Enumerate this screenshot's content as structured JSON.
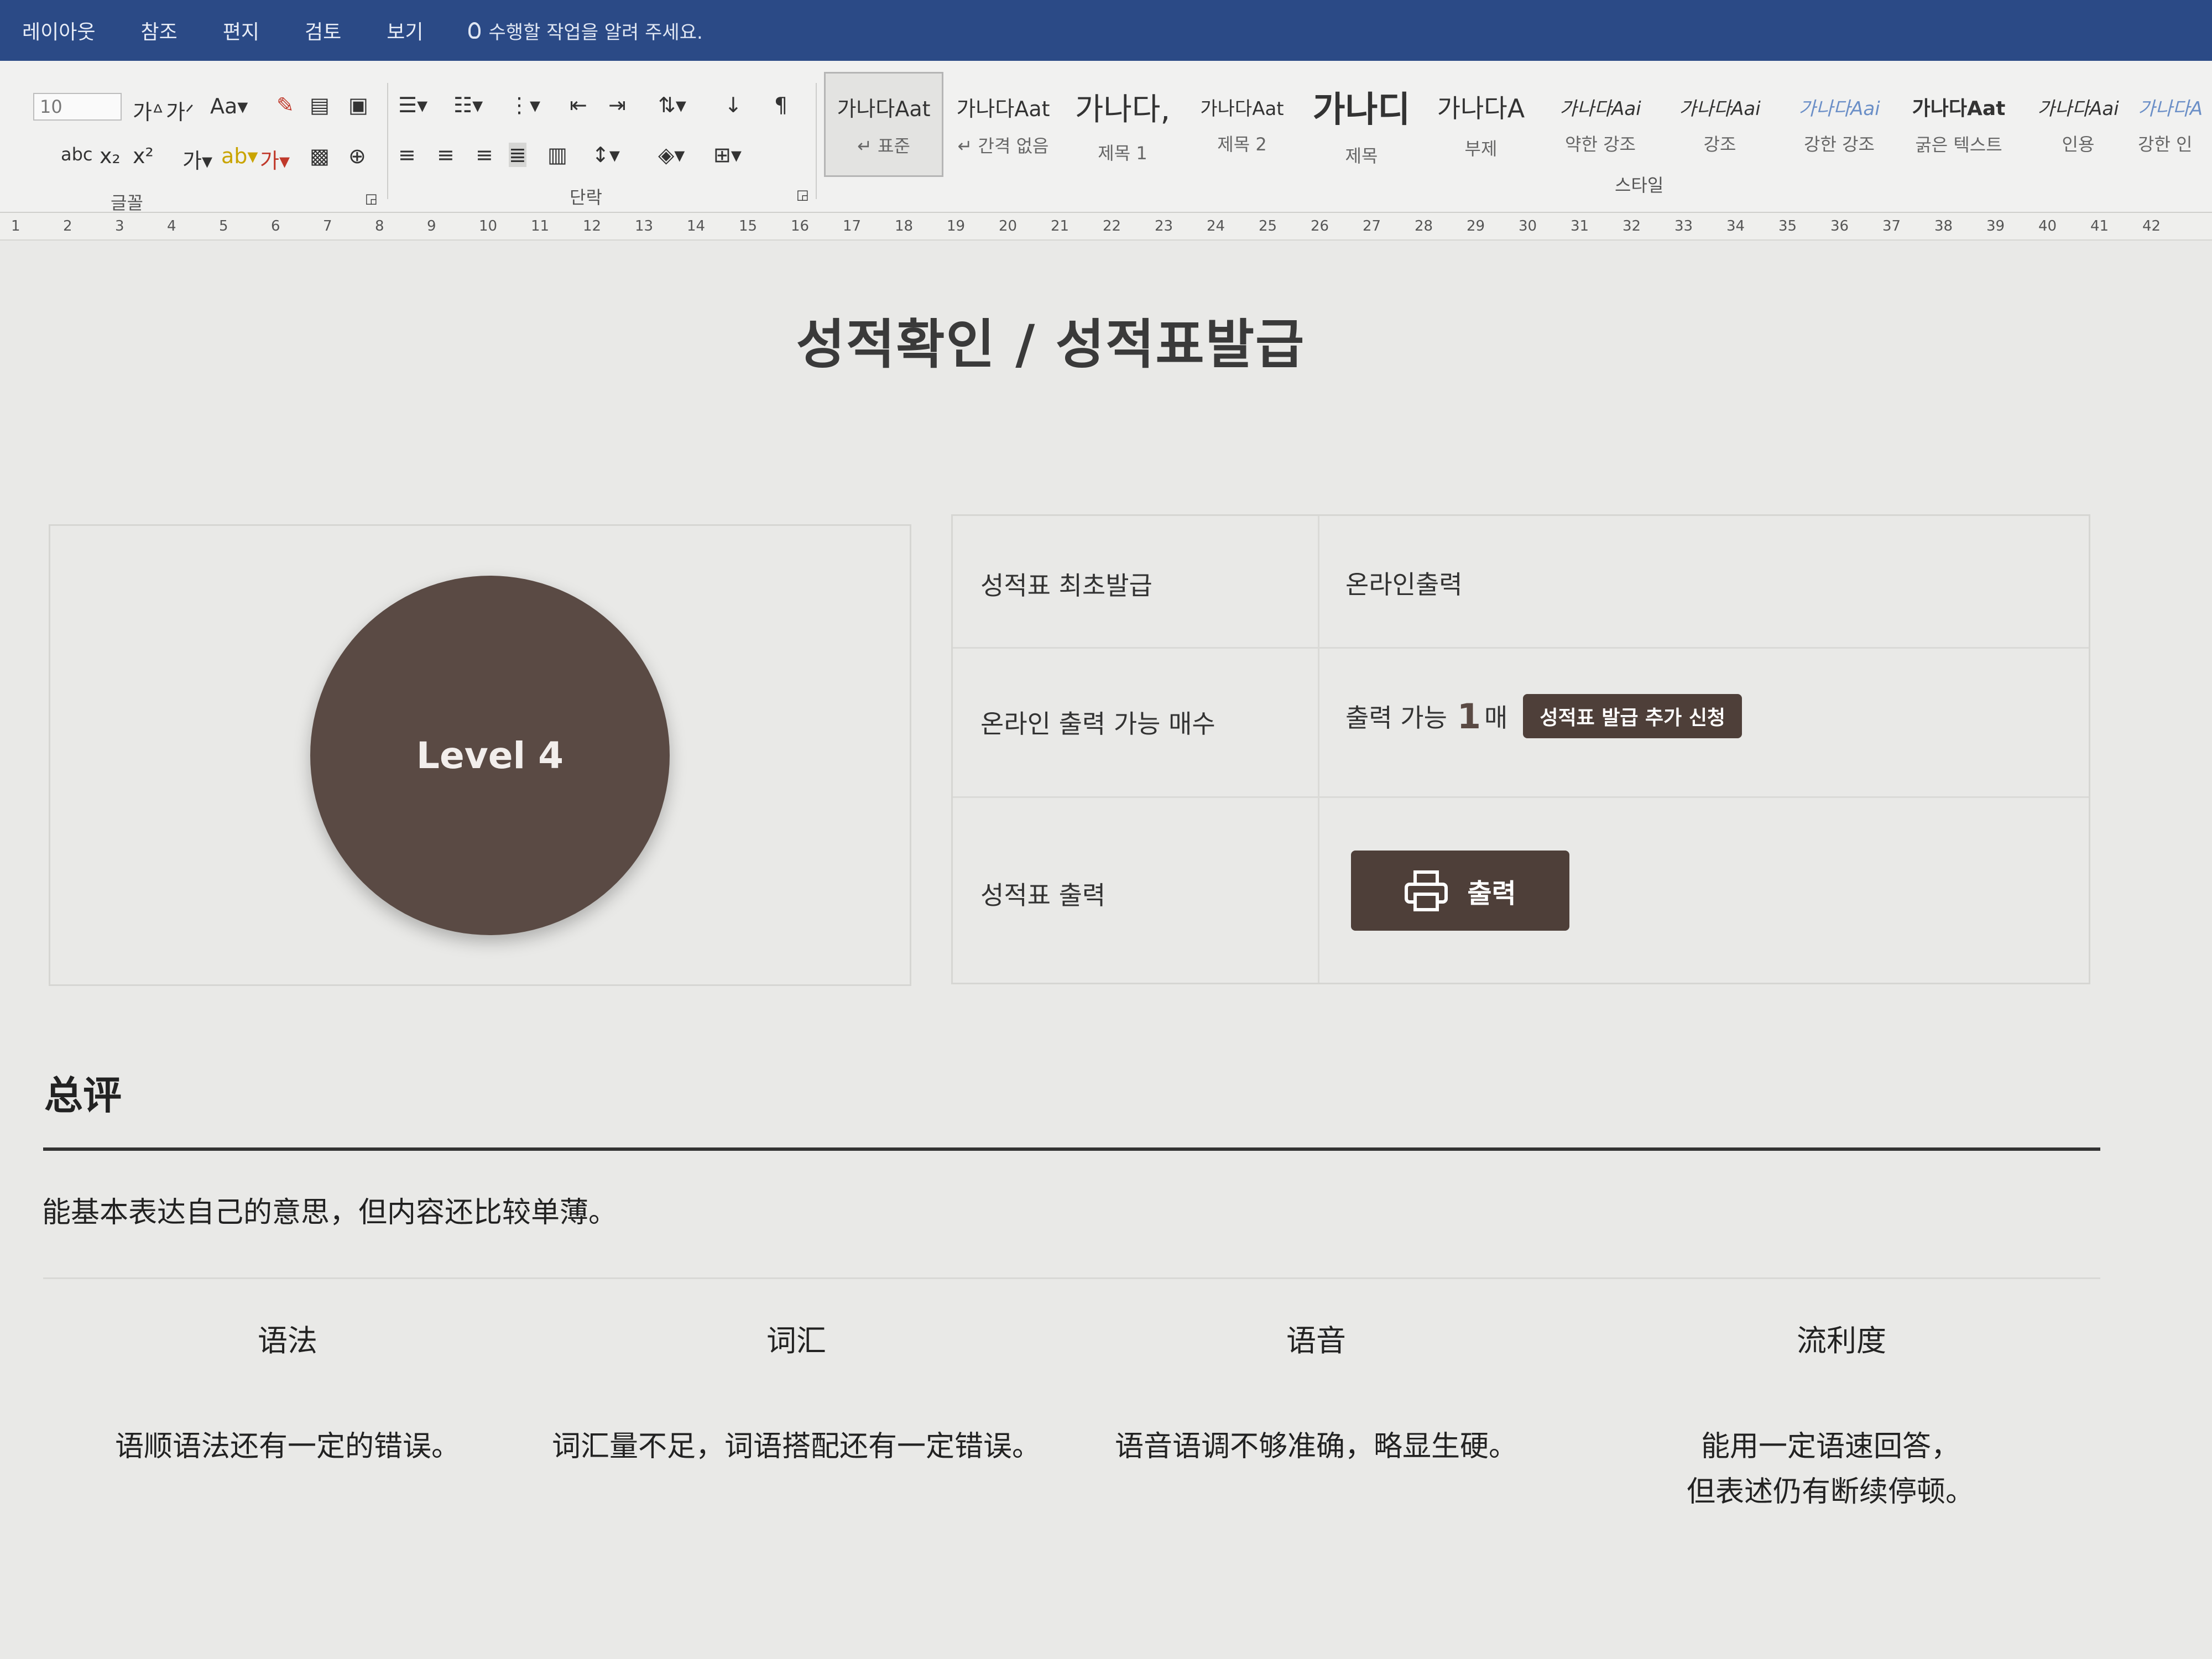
{
  "menubar": {
    "tabs": [
      "레이아웃",
      "참조",
      "편지",
      "검토",
      "보기"
    ],
    "tell_me": "수행할 작업을 알려 주세요."
  },
  "ribbon": {
    "font_size": "10",
    "group_font": "글꼴",
    "group_paragraph": "단락",
    "group_styles": "스타일",
    "styles": [
      {
        "sample": "가나다Aat",
        "name": "↵ 표준"
      },
      {
        "sample": "가나다Aat",
        "name": "↵ 간격 없음"
      },
      {
        "sample": "가나다,",
        "name": "제목 1"
      },
      {
        "sample": "가나다Aat",
        "name": "제목 2"
      },
      {
        "sample": "가나디",
        "name": "제목"
      },
      {
        "sample": "가나다A",
        "name": "부제"
      },
      {
        "sample": "가나다Aai",
        "name": "약한 강조"
      },
      {
        "sample": "가나다Aai",
        "name": "강조"
      },
      {
        "sample": "가나다Aai",
        "name": "강한 강조"
      },
      {
        "sample": "가나다Aat",
        "name": "굵은 텍스트"
      },
      {
        "sample": "가나다Aai",
        "name": "인용"
      },
      {
        "sample": "가나다A",
        "name": "강한 인"
      }
    ]
  },
  "ruler": [
    "1",
    "2",
    "3",
    "4",
    "5",
    "6",
    "7",
    "8",
    "9",
    "10",
    "11",
    "12",
    "13",
    "14",
    "15",
    "16",
    "17",
    "18",
    "19",
    "20",
    "21",
    "22",
    "23",
    "24",
    "25",
    "26",
    "27",
    "28",
    "29",
    "30",
    "31",
    "32",
    "33",
    "34",
    "35",
    "36",
    "37",
    "38",
    "39",
    "40",
    "41",
    "42"
  ],
  "page": {
    "title": "성적확인 / 성적표발급",
    "level": "Level 4",
    "rows": {
      "first_issue_label": "성적표 최초발급",
      "first_issue_value": "온라인출력",
      "online_count_label": "온라인 출력 가능 매수",
      "online_count_prefix": "출력 가능",
      "online_count_number": "1",
      "online_count_unit": "매",
      "add_request_button": "성적표 발급 추가 신청",
      "print_label": "성적표 출력",
      "print_button": "출력"
    },
    "summary_title": "总评",
    "summary_text": "能基本表达自己的意思，但内容还比较单薄。",
    "categories": [
      {
        "name": "语法",
        "comment": "语顺语法还有一定的错误。"
      },
      {
        "name": "词汇",
        "comment": "词汇量不足，词语搭配还有一定错误。"
      },
      {
        "name": "语音",
        "comment": "语音语调不够准确，略显生硬。"
      },
      {
        "name": "流利度",
        "comment": "能用一定语速回答，\n但表述仍有断续停顿。"
      }
    ]
  },
  "colors": {
    "accent": "#4e3f39",
    "circle": "#5a4a44",
    "titlebar": "#2b4a86"
  }
}
